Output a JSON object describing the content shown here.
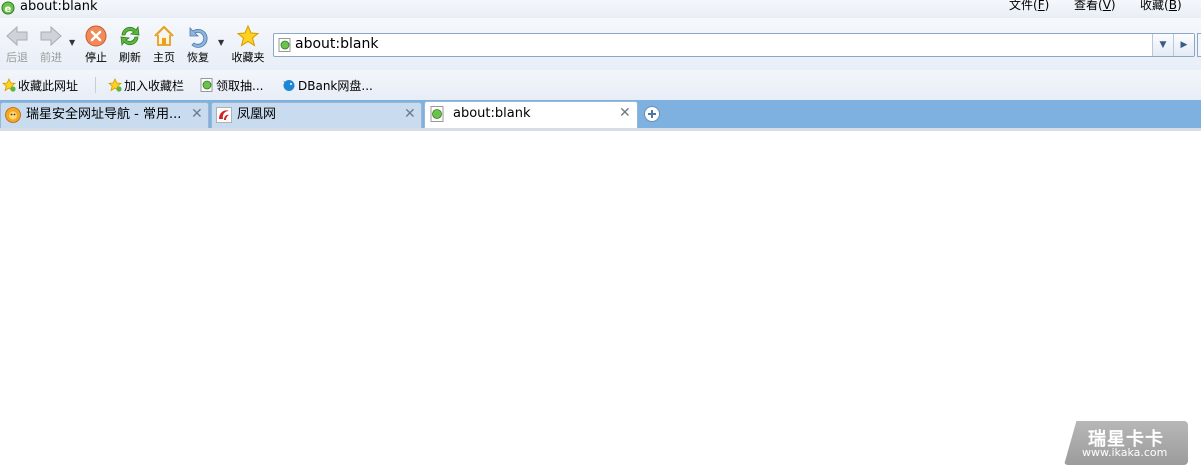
{
  "window": {
    "title": "about:blank"
  },
  "menu": [
    {
      "label": "文件",
      "key": "F"
    },
    {
      "label": "查看",
      "key": "V"
    },
    {
      "label": "收藏",
      "key": "B"
    }
  ],
  "toolbar": {
    "back_label": "后退",
    "forward_label": "前进",
    "stop_label": "停止",
    "refresh_label": "刷新",
    "home_label": "主页",
    "restore_label": "恢复",
    "favorites_label": "收藏夹"
  },
  "address": {
    "value": "about:blank"
  },
  "favorites_bar": [
    {
      "label": "收藏此网址",
      "icon": "star-add-icon"
    },
    {
      "label": "加入收藏栏",
      "icon": "star-add-icon"
    },
    {
      "label": "领取抽...",
      "icon": "ie-page-icon"
    },
    {
      "label": "DBank网盘...",
      "icon": "dbank-bird-icon"
    }
  ],
  "tabs": [
    {
      "title": "瑞星安全网址导航 - 常用...",
      "active": false,
      "icon": "rising-lion-icon"
    },
    {
      "title": "凤凰网",
      "active": false,
      "icon": "ifeng-logo-icon"
    },
    {
      "title": "about:blank",
      "active": true,
      "icon": "ie-page-icon"
    }
  ],
  "watermark": {
    "title": "瑞星卡卡",
    "url": "www.ikaka.com"
  },
  "colors": {
    "tabstrip": "#7fb1e0",
    "tab_inactive": "#c9dcef",
    "accent": "#3a8a2a"
  }
}
